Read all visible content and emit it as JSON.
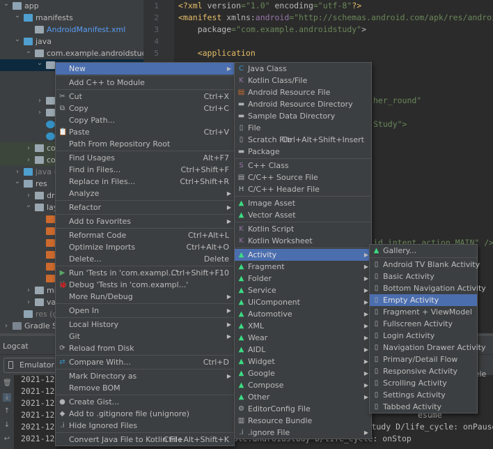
{
  "project_tree": [
    {
      "label": "app",
      "level": 0,
      "expanded": true,
      "icon": "module-folder-icon"
    },
    {
      "label": "manifests",
      "level": 1,
      "expanded": true,
      "icon": "folder-icon"
    },
    {
      "label": "AndroidManifest.xml",
      "level": 2,
      "icon": "manifest-file-icon",
      "color": "#589df6"
    },
    {
      "label": "java",
      "level": 1,
      "expanded": true,
      "icon": "folder-icon"
    },
    {
      "label": "com.example.androidstudy",
      "level": 2,
      "expanded": true,
      "icon": "package-icon"
    },
    {
      "label": "Android",
      "level": 3,
      "expanded": true,
      "icon": "package-icon",
      "selected": true
    },
    {
      "label": "",
      "level": 4,
      "icon": "file-icon"
    },
    {
      "label": "",
      "level": 4,
      "icon": "file-icon"
    },
    {
      "label": "a",
      "level": 3,
      "expanded": false,
      "icon": "package-icon"
    },
    {
      "label": "k",
      "level": 3,
      "expanded": false,
      "icon": "package-icon"
    },
    {
      "label": "L",
      "level": 3,
      "icon": "kotlin-class-icon",
      "color": "#62b543"
    },
    {
      "label": "M",
      "level": 3,
      "icon": "kotlin-class-icon"
    },
    {
      "label": "com",
      "level": 2,
      "expanded": false,
      "icon": "package-icon",
      "test": true
    },
    {
      "label": "com",
      "level": 2,
      "expanded": false,
      "icon": "package-icon",
      "test": true
    },
    {
      "label": "java (ge",
      "level": 1,
      "expanded": false,
      "icon": "generated-folder-icon",
      "color": "#808080"
    },
    {
      "label": "res",
      "level": 1,
      "expanded": true,
      "icon": "res-folder-icon"
    },
    {
      "label": "draw",
      "level": 2,
      "expanded": false,
      "icon": "package-icon"
    },
    {
      "label": "layo",
      "level": 2,
      "expanded": true,
      "icon": "package-icon"
    },
    {
      "label": "a",
      "level": 3,
      "icon": "layout-file-icon",
      "color": "#62b543"
    },
    {
      "label": "a",
      "level": 3,
      "icon": "layout-file-icon",
      "color": "#589df6"
    },
    {
      "label": "l",
      "level": 3,
      "icon": "layout-file-icon"
    },
    {
      "label": "p",
      "level": 3,
      "icon": "layout-file-icon"
    },
    {
      "label": "r",
      "level": 3,
      "icon": "layout-file-icon"
    },
    {
      "label": "r",
      "level": 3,
      "icon": "layout-file-icon"
    },
    {
      "label": "mip",
      "level": 2,
      "expanded": false,
      "icon": "package-icon"
    },
    {
      "label": "valu",
      "level": 2,
      "expanded": false,
      "icon": "package-icon"
    },
    {
      "label": "res (ger",
      "level": 1,
      "icon": "res-folder-icon",
      "color": "#808080"
    },
    {
      "label": "Gradle Scri",
      "level": 0,
      "expanded": false,
      "icon": "gradle-icon"
    }
  ],
  "editor": {
    "line_numbers": [
      "1",
      "2",
      "3",
      "4",
      "5"
    ],
    "lines": [
      {
        "parts": [
          [
            "tag",
            "<?xml "
          ],
          [
            "attr",
            "version"
          ],
          [
            "str",
            "=\"1.0\" "
          ],
          [
            "attr",
            "encoding"
          ],
          [
            "str",
            "=\"utf-8\""
          ],
          [
            "tag",
            "?>"
          ]
        ]
      },
      {
        "parts": [
          [
            "tag",
            "<manifest "
          ],
          [
            "attr",
            "xmlns:"
          ],
          [
            "ns",
            "android"
          ],
          [
            "str",
            "=\"http://schemas.android.com/apk/res/android\""
          ]
        ]
      },
      {
        "parts": [
          [
            "attr",
            "    package"
          ],
          [
            "str",
            "=\"com.example.androidstudy\""
          ],
          [
            "attr",
            ">"
          ]
        ]
      },
      {
        "parts": []
      },
      {
        "parts": [
          [
            "tag",
            "    <application"
          ]
        ]
      }
    ],
    "fragments": [
      {
        "line": 9,
        "text": "her_round\""
      },
      {
        "line": 11,
        "text": "Study\">"
      },
      {
        "line": 21,
        "text": "id.intent.action.MAIN\" />"
      },
      {
        "line": 23,
        "text": "UNCHE"
      }
    ]
  },
  "logcat": {
    "title": "Logcat",
    "device": "Emulator Ne",
    "right_text": "y sele",
    "lines": [
      {
        "left": "2021-12-",
        "right": ""
      },
      {
        "left": "2021-12-",
        "right": ""
      },
      {
        "left": "2021-12-",
        "right": ""
      },
      {
        "left": "2021-12-",
        "right": "esume"
      },
      {
        "left": "2021-12-",
        "right": "ndroidstudy D/life_cycle: onPause"
      },
      {
        "left": "2021-12-27 09:26:16.859 15496-15496/com.example.androidstudy D/life_cycle: onStop",
        "right": ""
      }
    ]
  },
  "context_menu": [
    {
      "label": "New",
      "submenu": true,
      "highlighted": true
    },
    {
      "separator": true
    },
    {
      "label": "Add C++ to Module"
    },
    {
      "separator": true
    },
    {
      "label": "Cut",
      "shortcut": "Ctrl+X",
      "icon": "scissors-icon"
    },
    {
      "label": "Copy",
      "shortcut": "Ctrl+C",
      "icon": "copy-icon"
    },
    {
      "label": "Copy Path..."
    },
    {
      "label": "Paste",
      "shortcut": "Ctrl+V",
      "icon": "clipboard-icon"
    },
    {
      "label": "Path From Repository Root"
    },
    {
      "separator": true
    },
    {
      "label": "Find Usages",
      "shortcut": "Alt+F7"
    },
    {
      "label": "Find in Files...",
      "shortcut": "Ctrl+Shift+F"
    },
    {
      "label": "Replace in Files...",
      "shortcut": "Ctrl+Shift+R"
    },
    {
      "label": "Analyze",
      "submenu": true
    },
    {
      "separator": true
    },
    {
      "label": "Refactor",
      "submenu": true
    },
    {
      "separator": true
    },
    {
      "label": "Add to Favorites",
      "submenu": true
    },
    {
      "separator": true
    },
    {
      "label": "Reformat Code",
      "shortcut": "Ctrl+Alt+L"
    },
    {
      "label": "Optimize Imports",
      "shortcut": "Ctrl+Alt+O"
    },
    {
      "label": "Delete...",
      "shortcut": "Delete"
    },
    {
      "separator": true
    },
    {
      "label": "Run 'Tests in 'com.exampl...'",
      "shortcut": "Ctrl+Shift+F10",
      "icon": "run-icon"
    },
    {
      "label": "Debug 'Tests in 'com.exampl...'",
      "icon": "debug-icon"
    },
    {
      "label": "More Run/Debug",
      "submenu": true
    },
    {
      "separator": true
    },
    {
      "label": "Open In",
      "submenu": true
    },
    {
      "separator": true
    },
    {
      "label": "Local History",
      "submenu": true
    },
    {
      "label": "Git",
      "submenu": true
    },
    {
      "label": "Reload from Disk",
      "icon": "reload-icon"
    },
    {
      "separator": true
    },
    {
      "label": "Compare With...",
      "shortcut": "Ctrl+D",
      "icon": "compare-icon"
    },
    {
      "separator": true
    },
    {
      "label": "Mark Directory as",
      "submenu": true
    },
    {
      "label": "Remove BOM"
    },
    {
      "separator": true
    },
    {
      "label": "Create Gist...",
      "icon": "github-icon"
    },
    {
      "label": "Add to .gitignore file (unignore)",
      "icon": "gitignore-icon"
    },
    {
      "label": "Hide Ignored Files",
      "icon": "ignore-file-icon"
    },
    {
      "separator": true
    },
    {
      "label": "Convert Java File to Kotlin File",
      "shortcut": "Ctrl+Alt+Shift+K"
    }
  ],
  "new_submenu": [
    {
      "label": "Java Class",
      "icon": "java-class-icon"
    },
    {
      "label": "Kotlin Class/File",
      "icon": "kotlin-file-icon"
    },
    {
      "label": "Android Resource File",
      "icon": "resource-file-icon"
    },
    {
      "label": "Android Resource Directory",
      "icon": "folder-icon"
    },
    {
      "label": "Sample Data Directory",
      "icon": "folder-icon"
    },
    {
      "label": "File",
      "icon": "file-icon"
    },
    {
      "label": "Scratch File",
      "shortcut": "Ctrl+Alt+Shift+Insert",
      "icon": "scratch-file-icon"
    },
    {
      "label": "Package",
      "icon": "package-icon"
    },
    {
      "separator": true
    },
    {
      "label": "C++ Class",
      "icon": "cpp-class-icon"
    },
    {
      "label": "C/C++ Source File",
      "icon": "cpp-source-icon"
    },
    {
      "label": "C/C++ Header File",
      "icon": "cpp-header-icon"
    },
    {
      "separator": true
    },
    {
      "label": "Image Asset",
      "icon": "android-icon"
    },
    {
      "label": "Vector Asset",
      "icon": "android-icon"
    },
    {
      "separator": true
    },
    {
      "label": "Kotlin Script",
      "icon": "kotlin-script-icon"
    },
    {
      "label": "Kotlin Worksheet",
      "icon": "kotlin-script-icon"
    },
    {
      "separator": true
    },
    {
      "label": "Activity",
      "icon": "android-icon",
      "submenu": true,
      "highlighted": true
    },
    {
      "label": "Fragment",
      "icon": "android-icon",
      "submenu": true
    },
    {
      "label": "Folder",
      "icon": "android-icon",
      "submenu": true
    },
    {
      "label": "Service",
      "icon": "android-icon",
      "submenu": true
    },
    {
      "label": "UiComponent",
      "icon": "android-icon",
      "submenu": true
    },
    {
      "label": "Automotive",
      "icon": "android-icon",
      "submenu": true
    },
    {
      "label": "XML",
      "icon": "android-icon",
      "submenu": true
    },
    {
      "label": "Wear",
      "icon": "android-icon",
      "submenu": true
    },
    {
      "label": "AIDL",
      "icon": "android-icon",
      "submenu": true
    },
    {
      "label": "Widget",
      "icon": "android-icon",
      "submenu": true
    },
    {
      "label": "Google",
      "icon": "android-icon",
      "submenu": true
    },
    {
      "label": "Compose",
      "icon": "android-icon",
      "submenu": true
    },
    {
      "label": "Other",
      "icon": "android-icon",
      "submenu": true
    },
    {
      "label": "EditorConfig File",
      "icon": "gear-icon"
    },
    {
      "label": "Resource Bundle",
      "icon": "resource-bundle-icon"
    },
    {
      "label": ".ignore File",
      "icon": "ignore-file-icon",
      "submenu": true
    }
  ],
  "activity_submenu": [
    {
      "label": "Gallery...",
      "icon": "android-icon"
    },
    {
      "separator": true
    },
    {
      "label": "Android TV Blank Activity",
      "icon": "phone-icon"
    },
    {
      "label": "Basic Activity",
      "icon": "phone-icon"
    },
    {
      "label": "Bottom Navigation Activity",
      "icon": "phone-icon"
    },
    {
      "label": "Empty Activity",
      "icon": "phone-icon",
      "highlighted": true
    },
    {
      "label": "Fragment + ViewModel",
      "icon": "phone-icon"
    },
    {
      "label": "Fullscreen Activity",
      "icon": "phone-icon"
    },
    {
      "label": "Login Activity",
      "icon": "phone-icon"
    },
    {
      "label": "Navigation Drawer Activity",
      "icon": "phone-icon"
    },
    {
      "label": "Primary/Detail Flow",
      "icon": "phone-icon"
    },
    {
      "label": "Responsive Activity",
      "icon": "phone-icon"
    },
    {
      "label": "Scrolling Activity",
      "icon": "phone-icon"
    },
    {
      "label": "Settings Activity",
      "icon": "phone-icon"
    },
    {
      "label": "Tabbed Activity",
      "icon": "phone-icon"
    }
  ],
  "colors": {
    "menu_highlight": "#4b6eaf",
    "menu_bg": "#3c3f41",
    "selection": "#0d293e",
    "android_green": "#3ddc84"
  }
}
